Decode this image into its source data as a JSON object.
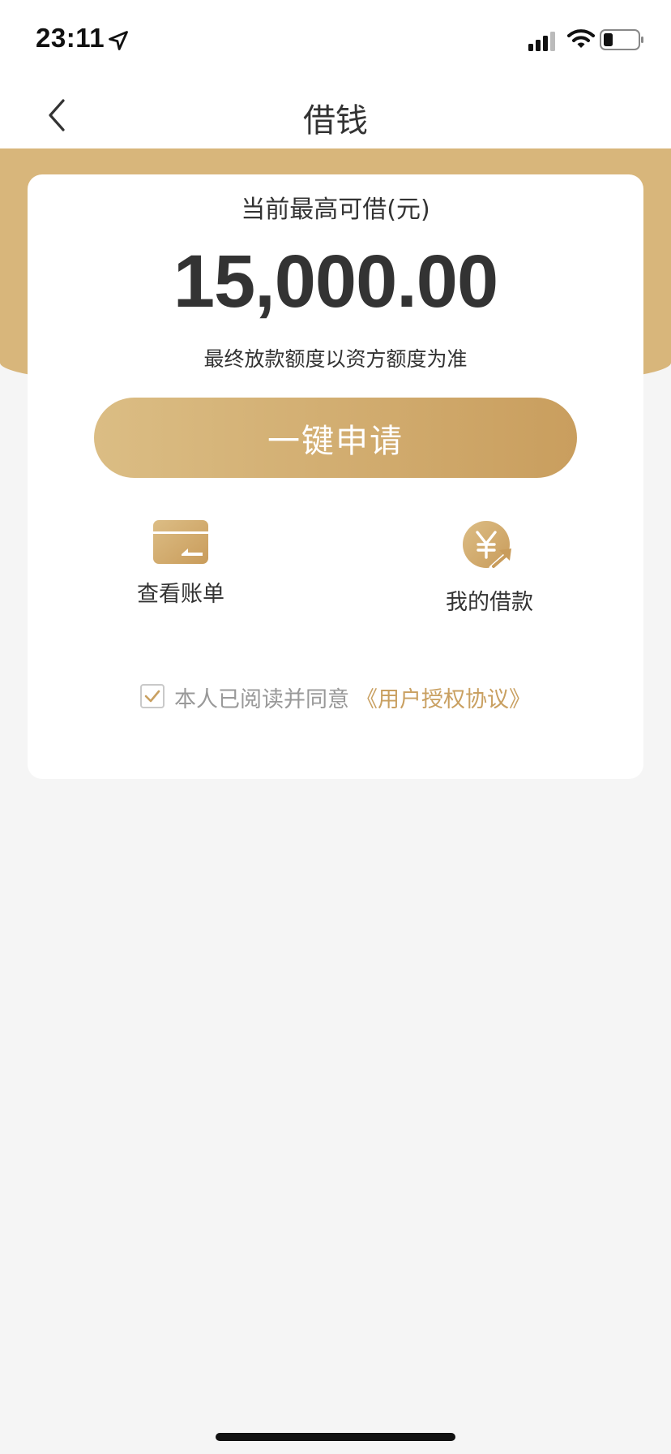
{
  "status_bar": {
    "time": "23:11",
    "icons": [
      "location-arrow-icon",
      "signal-icon",
      "wifi-icon",
      "battery-icon"
    ]
  },
  "nav": {
    "back_icon": "chevron-left-icon",
    "title": "借钱"
  },
  "card": {
    "limit_label": "当前最高可借(元)",
    "amount": "15,000.00",
    "note": "最终放款额度以资方额度为准",
    "apply_button": "一键申请",
    "actions": [
      {
        "label": "查看账单",
        "icon": "bill-card-icon"
      },
      {
        "label": "我的借款",
        "icon": "yuan-coin-icon"
      }
    ],
    "agreement": {
      "checked": true,
      "text": "本人已阅读并同意",
      "link": "《用户授权协议》"
    }
  },
  "colors": {
    "gold": "#d8b67b",
    "gold_dark": "#c99e5e",
    "link": "#c9a061",
    "background": "#f5f5f5"
  }
}
